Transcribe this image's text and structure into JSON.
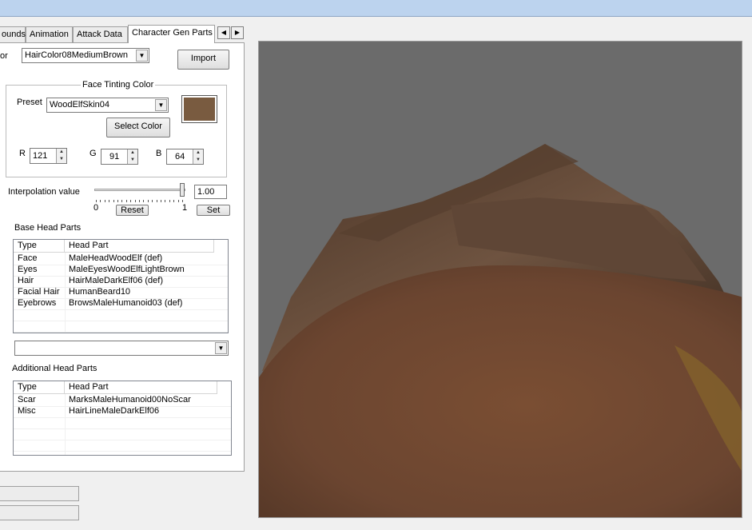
{
  "tabs": [
    {
      "label": "ounds",
      "active": false
    },
    {
      "label": "Animation",
      "active": false
    },
    {
      "label": "Attack Data",
      "active": false
    },
    {
      "label": "Character Gen Parts",
      "active": true
    }
  ],
  "hair_color": {
    "label": "or",
    "value": "HairColor08MediumBrown"
  },
  "import_label": "Import",
  "face_tinting": {
    "title": "Face Tinting Color",
    "preset_label": "Preset",
    "preset_value": "WoodElfSkin04",
    "select_color_label": "Select Color",
    "swatch_color": "#795B40",
    "r_label": "R",
    "r_value": "121",
    "g_label": "G",
    "g_value": "91",
    "b_label": "B",
    "b_value": "64"
  },
  "interpolation": {
    "label": "Interpolation value",
    "value": "1.00",
    "min_label": "0",
    "max_label": "1",
    "slider_fraction": 1.0,
    "reset_label": "Reset",
    "set_label": "Set"
  },
  "base_head_parts": {
    "title": "Base Head Parts",
    "col_type": "Type",
    "col_part": "Head Part",
    "rows": [
      {
        "type": "Face",
        "part": "MaleHeadWoodElf (def)"
      },
      {
        "type": "Eyes",
        "part": "MaleEyesWoodElfLightBrown"
      },
      {
        "type": "Hair",
        "part": "HairMaleDarkElf06 (def)"
      },
      {
        "type": "Facial Hair",
        "part": "HumanBeard10"
      },
      {
        "type": "Eyebrows",
        "part": "BrowsMaleHumanoid03 (def)"
      }
    ]
  },
  "part_dropdown_value": "",
  "additional_head_parts": {
    "title": "Additional Head Parts",
    "col_type": "Type",
    "col_part": "Head Part",
    "rows": [
      {
        "type": "Scar",
        "part": "MarksMaleHumanoid00NoScar"
      },
      {
        "type": "Misc",
        "part": "HairLineMaleDarkElf06"
      }
    ]
  },
  "colors": {
    "viewport_bg": "#6b6b6b",
    "titlebar": "#bcd3ee"
  }
}
